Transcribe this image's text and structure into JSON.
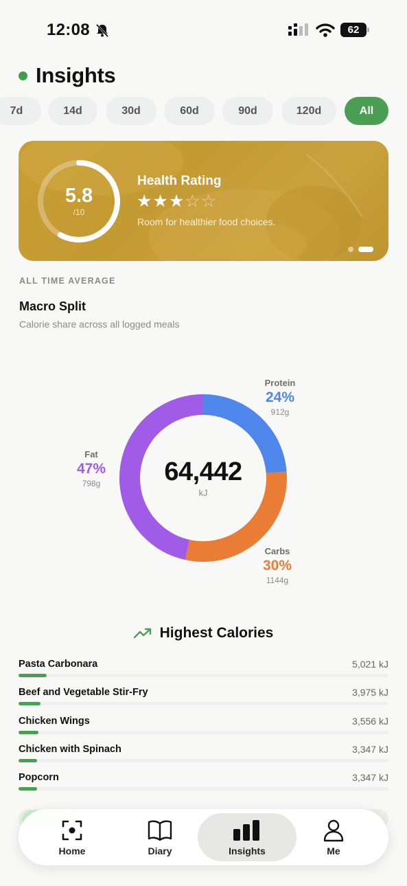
{
  "status_bar": {
    "time": "12:08",
    "battery": "62"
  },
  "header": {
    "title": "Insights"
  },
  "ranges": [
    "7d",
    "14d",
    "30d",
    "60d",
    "90d",
    "120d",
    "All"
  ],
  "active_range": "All",
  "health_card": {
    "score": "5.8",
    "scale": "/10",
    "score_value": 5.8,
    "score_max": 10,
    "title": "Health Rating",
    "stars_filled": 3,
    "stars_total": 5,
    "subtitle": "Room for healthier food choices.",
    "page_index": 1,
    "page_count": 2
  },
  "macro": {
    "caption": "ALL TIME AVERAGE",
    "title": "Macro Split",
    "subtitle": "Calorie share across all logged meals",
    "total": "64,442",
    "unit": "kJ",
    "protein": {
      "name": "Protein",
      "pct": "24%",
      "grams": "912g"
    },
    "carbs": {
      "name": "Carbs",
      "pct": "30%",
      "grams": "1144g"
    },
    "fat": {
      "name": "Fat",
      "pct": "47%",
      "grams": "798g"
    }
  },
  "chart_data": {
    "type": "pie",
    "categories": [
      "Protein",
      "Carbs",
      "Fat"
    ],
    "values": [
      24,
      30,
      47
    ],
    "grams": [
      912,
      1144,
      798
    ],
    "colors": [
      "#4f86eb",
      "#ea7d36",
      "#a05ce6"
    ],
    "center_value": "64,442",
    "center_unit": "kJ"
  },
  "highest_calories": {
    "title": "Highest Calories",
    "items": [
      {
        "name": "Pasta Carbonara",
        "kj": "5,021 kJ",
        "value": 5021
      },
      {
        "name": "Beef and Vegetable Stir-Fry",
        "kj": "3,975 kJ",
        "value": 3975
      },
      {
        "name": "Chicken Wings",
        "kj": "3,556 kJ",
        "value": 3556
      },
      {
        "name": "Chicken with Spinach",
        "kj": "3,347 kJ",
        "value": 3347
      },
      {
        "name": "Popcorn",
        "kj": "3,347 kJ",
        "value": 3347
      }
    ]
  },
  "colors": {
    "accent": "#4a9f55",
    "protein": "#4f86eb",
    "carbs": "#ea7d36",
    "fat": "#a05ce6",
    "card": "#c49a33"
  },
  "tabs": [
    {
      "label": "Home",
      "icon": "scan-icon"
    },
    {
      "label": "Diary",
      "icon": "book-icon"
    },
    {
      "label": "Insights",
      "icon": "bar-chart-icon"
    },
    {
      "label": "Me",
      "icon": "person-icon"
    }
  ],
  "active_tab": "Insights"
}
